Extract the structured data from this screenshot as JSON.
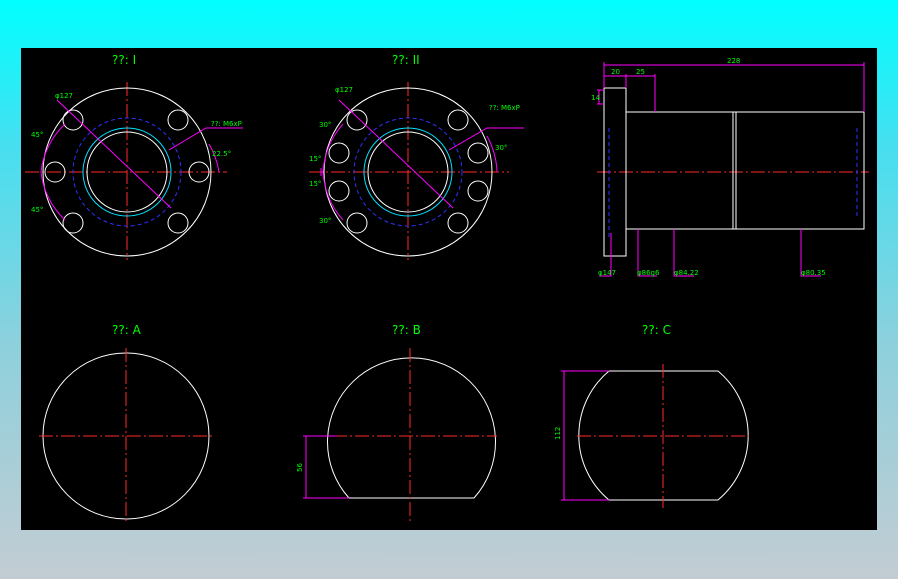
{
  "views": {
    "view1_title": "??: I",
    "view2_title": "??: II",
    "viewA_title": "??: A",
    "viewB_title": "??: B",
    "viewC_title": "??: C"
  },
  "dims": {
    "v1_dia": "φ127",
    "v1_holes": "??: M6xP",
    "v1_ang_top": "45°",
    "v1_ang_bot": "45°",
    "v1_ang_right": "22.5°",
    "v2_dia": "φ127",
    "v2_holes": "??: M6xP",
    "v2_ang1": "30°",
    "v2_ang2": "15°",
    "v2_ang3": "15°",
    "v2_ang4": "30°",
    "v2_ang_right": "30°",
    "side_20": "20",
    "side_25": "25",
    "side_228": "228",
    "side_14": "14",
    "lead1": "φ147",
    "lead2": "φ86g6",
    "lead3": "φ84.22",
    "lead4": "φ80.35",
    "viewB_56": "56",
    "viewC_112": "112"
  },
  "colors": {
    "canvas": "#000000",
    "centerline": "#ff2a2a",
    "outline": "#ffffff",
    "hidden": "#3030ff",
    "dimension": "#ff00ff",
    "text": "#00ff00"
  }
}
